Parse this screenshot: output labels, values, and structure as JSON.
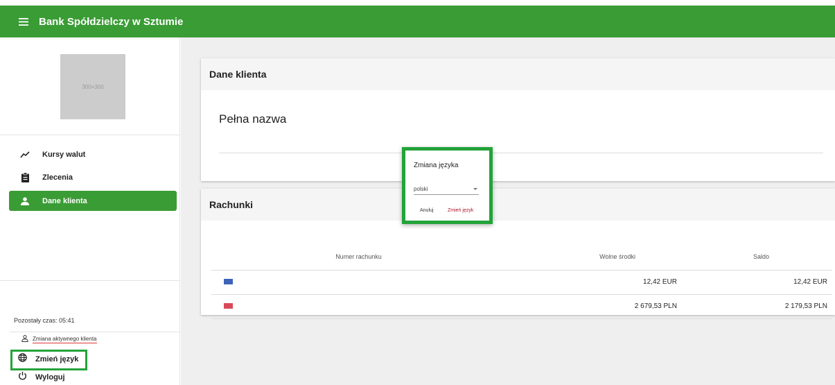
{
  "header": {
    "title": "Bank Spółdzielczy w Sztumie"
  },
  "sidebar": {
    "avatar_placeholder": "300×300",
    "items": [
      {
        "label": "Kursy walut",
        "icon": "trending-up-icon",
        "active": false
      },
      {
        "label": "Zlecenia",
        "icon": "clipboard-icon",
        "active": false
      },
      {
        "label": "Dane klienta",
        "icon": "person-icon",
        "active": true
      }
    ],
    "timer_text": "Pozostały czas: 05:41",
    "switch_client_label": "Zmiana aktywnego klienta",
    "change_language_label": "Zmień język",
    "logout_label": "Wyloguj"
  },
  "client_card": {
    "title": "Dane klienta",
    "full_name_label": "Pełna nazwa"
  },
  "accounts_card": {
    "title": "Rachunki",
    "columns": [
      "Numer rachunku",
      "Wolne środki",
      "Saldo"
    ],
    "rows": [
      {
        "flag": "eu",
        "available": "12,42 EUR",
        "balance": "12,42 EUR"
      },
      {
        "flag": "pl",
        "available": "2 679,53 PLN",
        "balance": "2 179,53 PLN"
      }
    ]
  },
  "language_dialog": {
    "title": "Zmiana języka",
    "selected_language": "polski",
    "cancel_label": "Anuluj",
    "confirm_label": "Zmień język"
  },
  "colors": {
    "brand": "#3a9c35",
    "highlight": "#23a33a",
    "confirm": "#b0122a"
  }
}
